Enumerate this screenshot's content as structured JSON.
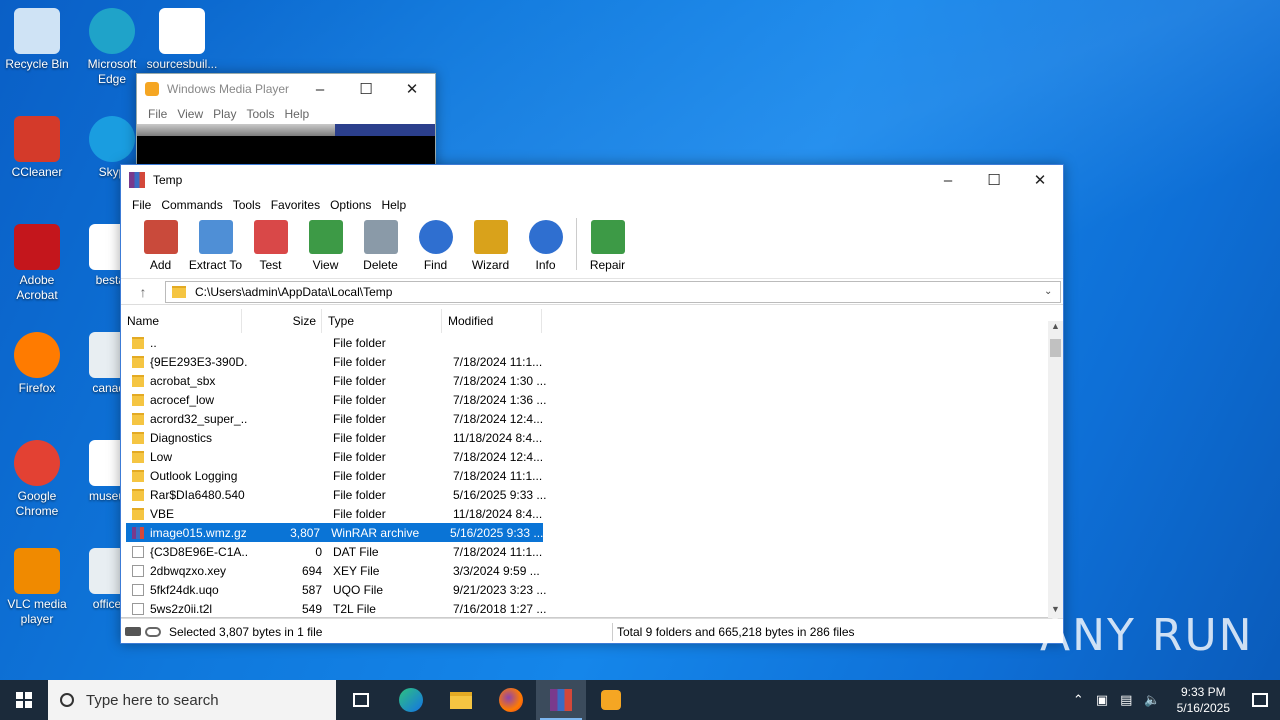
{
  "desktop_icons": [
    {
      "label1": "Recycle Bin",
      "label2": "",
      "icon": "recycle-bin-icon"
    },
    {
      "label1": "Microsoft",
      "label2": "Edge",
      "icon": "edge-icon"
    },
    {
      "label1": "sourcesbuil...",
      "label2": "",
      "icon": "word-doc-icon"
    },
    {
      "label1": "CCleaner",
      "label2": "",
      "icon": "ccleaner-icon"
    },
    {
      "label1": "Skyp",
      "label2": "",
      "icon": "skype-icon"
    },
    {
      "label1": "Adobe",
      "label2": "Acrobat",
      "icon": "acrobat-icon"
    },
    {
      "label1": "bestat",
      "label2": "",
      "icon": "word-doc-icon"
    },
    {
      "label1": "Firefox",
      "label2": "",
      "icon": "firefox-icon"
    },
    {
      "label1": "canada",
      "label2": "",
      "icon": "image-file-icon"
    },
    {
      "label1": "Google",
      "label2": "Chrome",
      "icon": "chrome-icon"
    },
    {
      "label1": "museum",
      "label2": "",
      "icon": "word-doc-icon"
    },
    {
      "label1": "VLC media",
      "label2": "player",
      "icon": "vlc-icon"
    },
    {
      "label1": "officerfi",
      "label2": "",
      "icon": "image-file-icon"
    }
  ],
  "wmp": {
    "title": "Windows Media Player",
    "menu": [
      "File",
      "View",
      "Play",
      "Tools",
      "Help"
    ]
  },
  "rar": {
    "title": "Temp",
    "menu": [
      "File",
      "Commands",
      "Tools",
      "Favorites",
      "Options",
      "Help"
    ],
    "toolbar": [
      "Add",
      "Extract To",
      "Test",
      "View",
      "Delete",
      "Find",
      "Wizard",
      "Info",
      "Repair"
    ],
    "path": "C:\\Users\\admin\\AppData\\Local\\Temp",
    "columns": {
      "name": "Name",
      "size": "Size",
      "type": "Type",
      "modified": "Modified"
    },
    "rows": [
      {
        "name": "..",
        "size": "",
        "type": "File folder",
        "modified": "",
        "kind": "folder"
      },
      {
        "name": "{9EE293E3-390D...",
        "size": "",
        "type": "File folder",
        "modified": "7/18/2024 11:1...",
        "kind": "folder"
      },
      {
        "name": "acrobat_sbx",
        "size": "",
        "type": "File folder",
        "modified": "7/18/2024 1:30 ...",
        "kind": "folder"
      },
      {
        "name": "acrocef_low",
        "size": "",
        "type": "File folder",
        "modified": "7/18/2024 1:36 ...",
        "kind": "folder"
      },
      {
        "name": "acrord32_super_...",
        "size": "",
        "type": "File folder",
        "modified": "7/18/2024 12:4...",
        "kind": "folder"
      },
      {
        "name": "Diagnostics",
        "size": "",
        "type": "File folder",
        "modified": "11/18/2024 8:4...",
        "kind": "folder"
      },
      {
        "name": "Low",
        "size": "",
        "type": "File folder",
        "modified": "7/18/2024 12:4...",
        "kind": "folder"
      },
      {
        "name": "Outlook Logging",
        "size": "",
        "type": "File folder",
        "modified": "7/18/2024 11:1...",
        "kind": "folder"
      },
      {
        "name": "Rar$DIa6480.540",
        "size": "",
        "type": "File folder",
        "modified": "5/16/2025 9:33 ...",
        "kind": "folder"
      },
      {
        "name": "VBE",
        "size": "",
        "type": "File folder",
        "modified": "11/18/2024 8:4...",
        "kind": "folder"
      },
      {
        "name": "image015.wmz.gz",
        "size": "3,807",
        "type": "WinRAR archive",
        "modified": "5/16/2025 9:33 ...",
        "kind": "rar"
      },
      {
        "name": "{C3D8E96E-C1A...",
        "size": "0",
        "type": "DAT File",
        "modified": "7/18/2024 11:1...",
        "kind": "file"
      },
      {
        "name": "2dbwqzxo.xey",
        "size": "694",
        "type": "XEY File",
        "modified": "3/3/2024 9:59 ...",
        "kind": "file"
      },
      {
        "name": "5fkf24dk.uqo",
        "size": "587",
        "type": "UQO File",
        "modified": "9/21/2023 3:23 ...",
        "kind": "file"
      },
      {
        "name": "5ws2z0ii.t2l",
        "size": "549",
        "type": "T2L File",
        "modified": "7/16/2018 1:27 ...",
        "kind": "file"
      }
    ],
    "status_left": "Selected 3,807 bytes in 1 file",
    "status_right": "Total 9 folders and 665,218 bytes in 286 files"
  },
  "taskbar": {
    "search_placeholder": "Type here to search",
    "time": "9:33 PM",
    "date": "5/16/2025"
  },
  "watermark": "ANY RUN"
}
